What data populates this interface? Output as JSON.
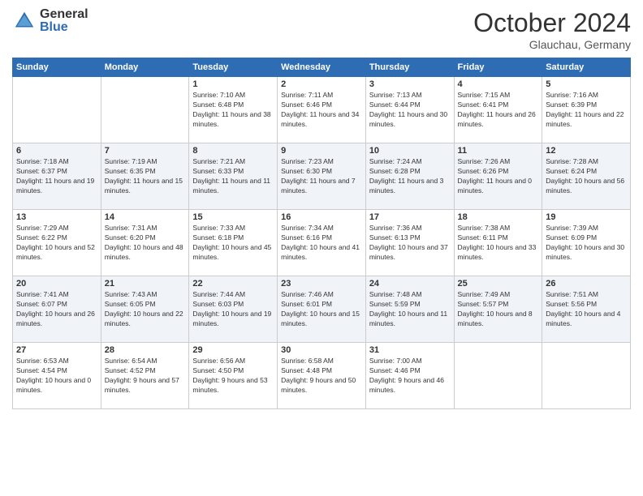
{
  "logo": {
    "general": "General",
    "blue": "Blue"
  },
  "title": "October 2024",
  "location": "Glauchau, Germany",
  "days_of_week": [
    "Sunday",
    "Monday",
    "Tuesday",
    "Wednesday",
    "Thursday",
    "Friday",
    "Saturday"
  ],
  "weeks": [
    [
      {
        "day": "",
        "info": ""
      },
      {
        "day": "",
        "info": ""
      },
      {
        "day": "1",
        "info": "Sunrise: 7:10 AM\nSunset: 6:48 PM\nDaylight: 11 hours and 38 minutes."
      },
      {
        "day": "2",
        "info": "Sunrise: 7:11 AM\nSunset: 6:46 PM\nDaylight: 11 hours and 34 minutes."
      },
      {
        "day": "3",
        "info": "Sunrise: 7:13 AM\nSunset: 6:44 PM\nDaylight: 11 hours and 30 minutes."
      },
      {
        "day": "4",
        "info": "Sunrise: 7:15 AM\nSunset: 6:41 PM\nDaylight: 11 hours and 26 minutes."
      },
      {
        "day": "5",
        "info": "Sunrise: 7:16 AM\nSunset: 6:39 PM\nDaylight: 11 hours and 22 minutes."
      }
    ],
    [
      {
        "day": "6",
        "info": "Sunrise: 7:18 AM\nSunset: 6:37 PM\nDaylight: 11 hours and 19 minutes."
      },
      {
        "day": "7",
        "info": "Sunrise: 7:19 AM\nSunset: 6:35 PM\nDaylight: 11 hours and 15 minutes."
      },
      {
        "day": "8",
        "info": "Sunrise: 7:21 AM\nSunset: 6:33 PM\nDaylight: 11 hours and 11 minutes."
      },
      {
        "day": "9",
        "info": "Sunrise: 7:23 AM\nSunset: 6:30 PM\nDaylight: 11 hours and 7 minutes."
      },
      {
        "day": "10",
        "info": "Sunrise: 7:24 AM\nSunset: 6:28 PM\nDaylight: 11 hours and 3 minutes."
      },
      {
        "day": "11",
        "info": "Sunrise: 7:26 AM\nSunset: 6:26 PM\nDaylight: 11 hours and 0 minutes."
      },
      {
        "day": "12",
        "info": "Sunrise: 7:28 AM\nSunset: 6:24 PM\nDaylight: 10 hours and 56 minutes."
      }
    ],
    [
      {
        "day": "13",
        "info": "Sunrise: 7:29 AM\nSunset: 6:22 PM\nDaylight: 10 hours and 52 minutes."
      },
      {
        "day": "14",
        "info": "Sunrise: 7:31 AM\nSunset: 6:20 PM\nDaylight: 10 hours and 48 minutes."
      },
      {
        "day": "15",
        "info": "Sunrise: 7:33 AM\nSunset: 6:18 PM\nDaylight: 10 hours and 45 minutes."
      },
      {
        "day": "16",
        "info": "Sunrise: 7:34 AM\nSunset: 6:16 PM\nDaylight: 10 hours and 41 minutes."
      },
      {
        "day": "17",
        "info": "Sunrise: 7:36 AM\nSunset: 6:13 PM\nDaylight: 10 hours and 37 minutes."
      },
      {
        "day": "18",
        "info": "Sunrise: 7:38 AM\nSunset: 6:11 PM\nDaylight: 10 hours and 33 minutes."
      },
      {
        "day": "19",
        "info": "Sunrise: 7:39 AM\nSunset: 6:09 PM\nDaylight: 10 hours and 30 minutes."
      }
    ],
    [
      {
        "day": "20",
        "info": "Sunrise: 7:41 AM\nSunset: 6:07 PM\nDaylight: 10 hours and 26 minutes."
      },
      {
        "day": "21",
        "info": "Sunrise: 7:43 AM\nSunset: 6:05 PM\nDaylight: 10 hours and 22 minutes."
      },
      {
        "day": "22",
        "info": "Sunrise: 7:44 AM\nSunset: 6:03 PM\nDaylight: 10 hours and 19 minutes."
      },
      {
        "day": "23",
        "info": "Sunrise: 7:46 AM\nSunset: 6:01 PM\nDaylight: 10 hours and 15 minutes."
      },
      {
        "day": "24",
        "info": "Sunrise: 7:48 AM\nSunset: 5:59 PM\nDaylight: 10 hours and 11 minutes."
      },
      {
        "day": "25",
        "info": "Sunrise: 7:49 AM\nSunset: 5:57 PM\nDaylight: 10 hours and 8 minutes."
      },
      {
        "day": "26",
        "info": "Sunrise: 7:51 AM\nSunset: 5:56 PM\nDaylight: 10 hours and 4 minutes."
      }
    ],
    [
      {
        "day": "27",
        "info": "Sunrise: 6:53 AM\nSunset: 4:54 PM\nDaylight: 10 hours and 0 minutes."
      },
      {
        "day": "28",
        "info": "Sunrise: 6:54 AM\nSunset: 4:52 PM\nDaylight: 9 hours and 57 minutes."
      },
      {
        "day": "29",
        "info": "Sunrise: 6:56 AM\nSunset: 4:50 PM\nDaylight: 9 hours and 53 minutes."
      },
      {
        "day": "30",
        "info": "Sunrise: 6:58 AM\nSunset: 4:48 PM\nDaylight: 9 hours and 50 minutes."
      },
      {
        "day": "31",
        "info": "Sunrise: 7:00 AM\nSunset: 4:46 PM\nDaylight: 9 hours and 46 minutes."
      },
      {
        "day": "",
        "info": ""
      },
      {
        "day": "",
        "info": ""
      }
    ]
  ]
}
